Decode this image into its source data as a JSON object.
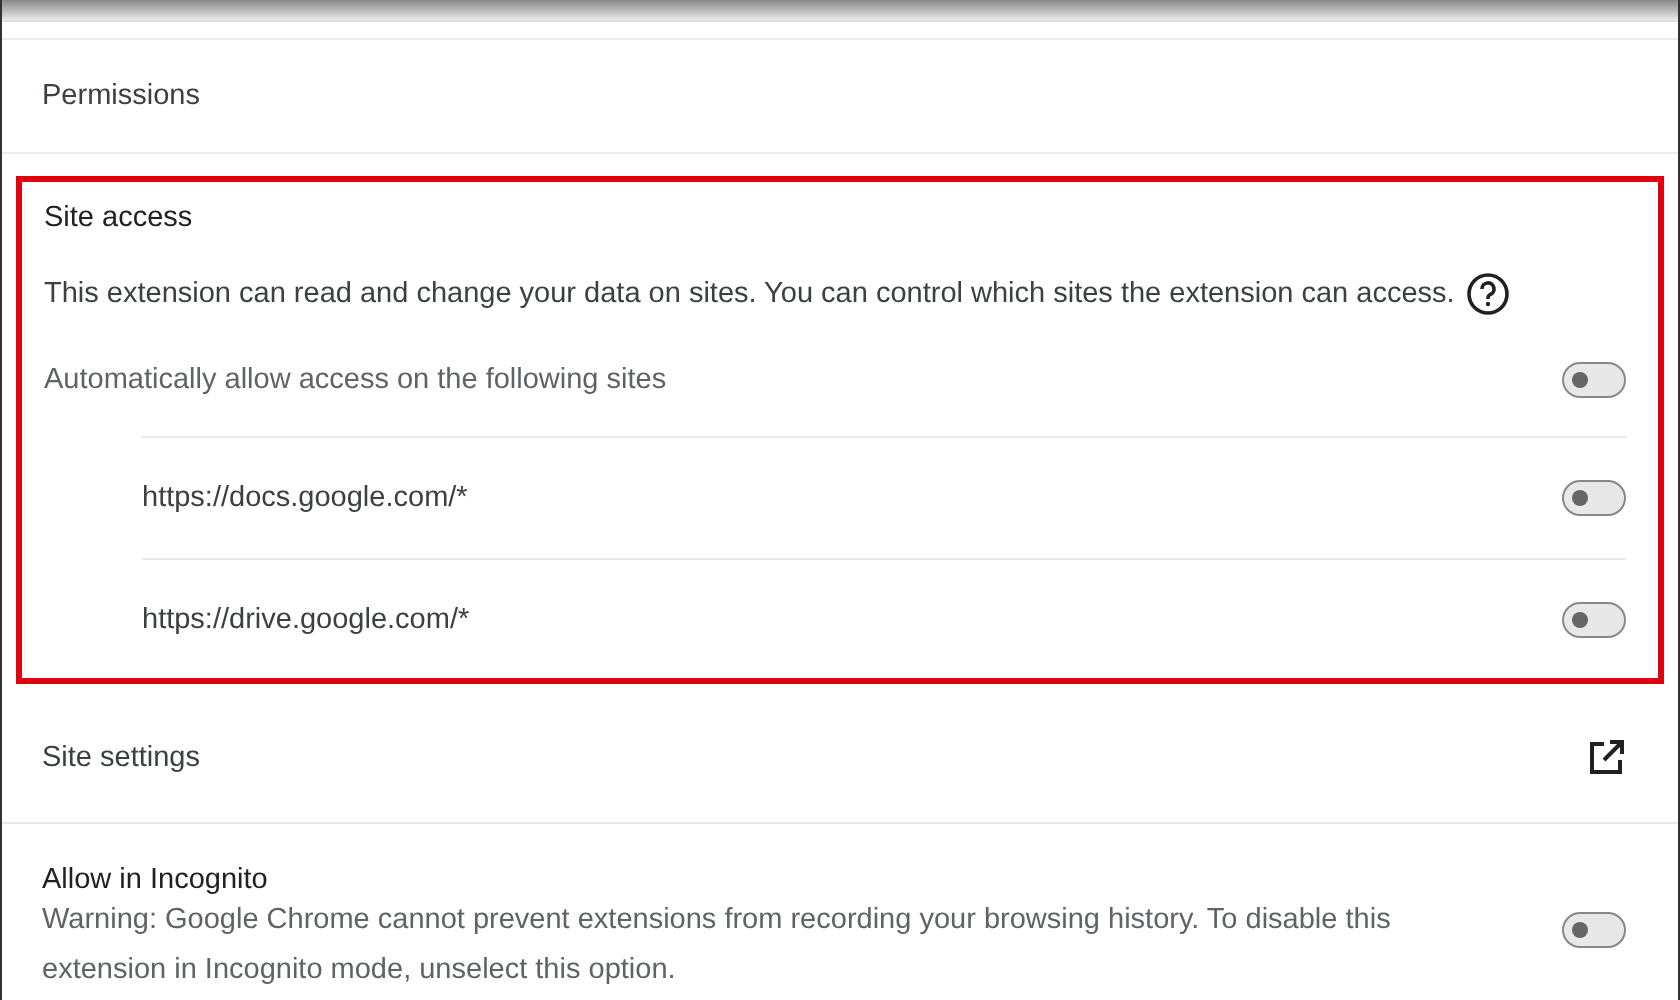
{
  "permissions": {
    "title": "Permissions"
  },
  "site_access": {
    "highlighted": true,
    "title": "Site access",
    "description": "This extension can read and change your data on sites. You can control which sites the extension can access.",
    "auto_allow": {
      "label": "Automatically allow access on the following sites",
      "on": false
    },
    "sites": [
      {
        "url": "https://docs.google.com/*",
        "on": false
      },
      {
        "url": "https://drive.google.com/*",
        "on": false
      }
    ]
  },
  "site_settings": {
    "label": "Site settings"
  },
  "incognito": {
    "title": "Allow in Incognito",
    "warning": "Warning: Google Chrome cannot prevent extensions from recording your browsing history. To disable this extension in Incognito mode, unselect this option.",
    "on": false
  }
}
